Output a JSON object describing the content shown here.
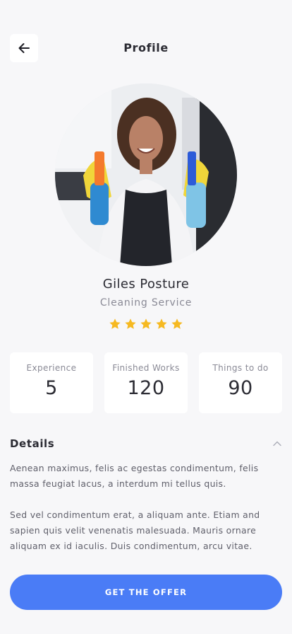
{
  "header": {
    "title": "Profile",
    "back_icon": "arrow-left-icon"
  },
  "profile": {
    "name": "Giles Posture",
    "role": "Cleaning Service",
    "rating": 5,
    "rating_max": 5,
    "star_color": "#f6b921"
  },
  "stats": [
    {
      "label": "Experience",
      "value": "5"
    },
    {
      "label": "Finished Works",
      "value": "120"
    },
    {
      "label": "Things to do",
      "value": "90"
    }
  ],
  "details": {
    "title": "Details",
    "toggle_icon": "chevron-up-icon",
    "paragraphs": [
      "Aenean maximus, felis ac egestas condimentum, felis massa feugiat lacus, a interdum mi tellus quis.",
      "Sed vel condimentum erat, a aliquam ante. Etiam and sapien quis velit venenatis malesuada. Mauris ornare aliquam ex id iaculis. Duis condimentum, arcu vitae."
    ]
  },
  "cta": {
    "label": "GET THE OFFER",
    "color": "#4a7cf6"
  }
}
